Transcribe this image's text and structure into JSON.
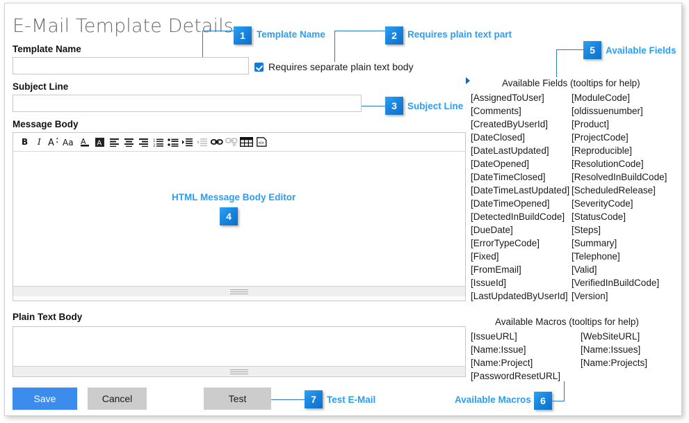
{
  "page": {
    "title": "E-Mail Template Details"
  },
  "form": {
    "template_name_label": "Template Name",
    "template_name_value": "",
    "subject_line_label": "Subject Line",
    "subject_line_value": "",
    "message_body_label": "Message Body",
    "message_body_value": "",
    "plain_text_body_label": "Plain Text Body",
    "plain_text_body_value": "",
    "plain_text_checkbox_label": "Requires separate plain text body",
    "plain_text_checkbox_checked": true
  },
  "toolbar": {
    "buttons": [
      {
        "icon": "bold-icon",
        "glyph": "B",
        "enabled": true
      },
      {
        "icon": "italic-icon",
        "glyph": "I",
        "enabled": true
      },
      {
        "icon": "font-size-icon",
        "glyph": "A",
        "enabled": true
      },
      {
        "icon": "font-name-icon",
        "glyph": "Aa",
        "enabled": true
      },
      {
        "icon": "text-color-icon",
        "glyph": "A",
        "enabled": true
      },
      {
        "icon": "text-highlight-icon",
        "glyph": "A",
        "enabled": true
      },
      {
        "icon": "align-left-icon",
        "glyph": "≡",
        "enabled": true
      },
      {
        "icon": "align-center-icon",
        "glyph": "≡",
        "enabled": true
      },
      {
        "icon": "align-right-icon",
        "glyph": "≡",
        "enabled": true
      },
      {
        "icon": "ordered-list-icon",
        "glyph": "≡",
        "enabled": true
      },
      {
        "icon": "unordered-list-icon",
        "glyph": "≡",
        "enabled": true
      },
      {
        "icon": "indent-increase-icon",
        "glyph": "≡",
        "enabled": true
      },
      {
        "icon": "indent-decrease-icon",
        "glyph": "≡",
        "enabled": false
      },
      {
        "icon": "insert-link-icon",
        "glyph": "⚭",
        "enabled": true
      },
      {
        "icon": "remove-link-icon",
        "glyph": "⚭",
        "enabled": false
      },
      {
        "icon": "insert-table-icon",
        "glyph": "▦",
        "enabled": true
      },
      {
        "icon": "view-html-source-icon",
        "glyph": "<>",
        "enabled": true
      }
    ]
  },
  "buttons": {
    "save": "Save",
    "cancel": "Cancel",
    "test": "Test"
  },
  "available_fields": {
    "heading": "Available Fields (tooltips for help)",
    "expander_icon": "triangle-right-icon",
    "column_left": [
      "[AssignedToUser]",
      "[Comments]",
      "[CreatedByUserId]",
      "[DateClosed]",
      "[DateLastUpdated]",
      "[DateOpened]",
      "[DateTimeClosed]",
      "[DateTimeLastUpdated]",
      "[DateTimeOpened]",
      "[DetectedInBuildCode]",
      "[DueDate]",
      "[ErrorTypeCode]",
      "[Fixed]",
      "[FromEmail]",
      "[IssueId]",
      "[LastUpdatedByUserId]"
    ],
    "column_right": [
      "[ModuleCode]",
      "[oldissuenumber]",
      "[Product]",
      "[ProjectCode]",
      "[Reproducible]",
      "[ResolutionCode]",
      "[ResolvedInBuildCode]",
      "[ScheduledRelease]",
      "[SeverityCode]",
      "[StatusCode]",
      "[Steps]",
      "[Summary]",
      "[Telephone]",
      "[Valid]",
      "[VerifiedInBuildCode]",
      "[Version]"
    ]
  },
  "available_macros": {
    "heading": "Available Macros (tooltips for help)",
    "column_left": [
      "[IssueURL]",
      "[Name:Issue]",
      "[Name:Project]",
      "[PasswordResetURL]"
    ],
    "column_right": [
      "[WebSiteURL]",
      "[Name:Issues]",
      "[Name:Projects]"
    ]
  },
  "callouts": [
    {
      "number": "1",
      "label": "Template Name"
    },
    {
      "number": "2",
      "label": "Requires plain text part"
    },
    {
      "number": "3",
      "label": "Subject Line"
    },
    {
      "number": "4",
      "label": "HTML Message Body Editor"
    },
    {
      "number": "5",
      "label": "Available Fields"
    },
    {
      "number": "6",
      "label": "Available Macros"
    },
    {
      "number": "7",
      "label": "Test E-Mail"
    }
  ],
  "colors": {
    "accent_blue": "#2a9df4",
    "badge_blue": "#1a86e0",
    "primary_button": "#3b8ced",
    "secondary_button": "#cccccc",
    "leader_line": "#2878c8",
    "title_gray": "#6b6b6b"
  }
}
